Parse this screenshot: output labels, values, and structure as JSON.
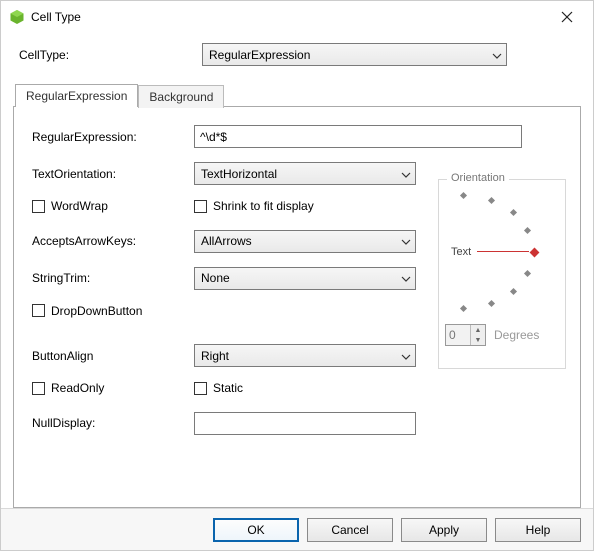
{
  "window": {
    "title": "Cell Type"
  },
  "cellType": {
    "label": "CellType:",
    "value": "RegularExpression"
  },
  "tabs": {
    "active": "RegularExpression",
    "inactive": "Background"
  },
  "form": {
    "regex": {
      "label": "RegularExpression:",
      "value": "^\\d*$"
    },
    "textOrientation": {
      "label": "TextOrientation:",
      "value": "TextHorizontal"
    },
    "wordWrap": {
      "label": "WordWrap"
    },
    "shrinkToFit": {
      "label": "Shrink to fit display"
    },
    "acceptsArrowKeys": {
      "label": "AcceptsArrowKeys:",
      "value": "AllArrows"
    },
    "stringTrim": {
      "label": "StringTrim:",
      "value": "None"
    },
    "dropDownButton": {
      "label": "DropDownButton"
    },
    "buttonAlign": {
      "label": "ButtonAlign",
      "value": "Right"
    },
    "readOnly": {
      "label": "ReadOnly"
    },
    "staticOpt": {
      "label": "Static"
    },
    "nullDisplay": {
      "label": "NullDisplay:",
      "value": ""
    }
  },
  "orientation": {
    "legend": "Orientation",
    "text": "Text",
    "degrees": "0",
    "degreesLabel": "Degrees"
  },
  "buttons": {
    "ok": "OK",
    "cancel": "Cancel",
    "apply": "Apply",
    "help": "Help"
  }
}
